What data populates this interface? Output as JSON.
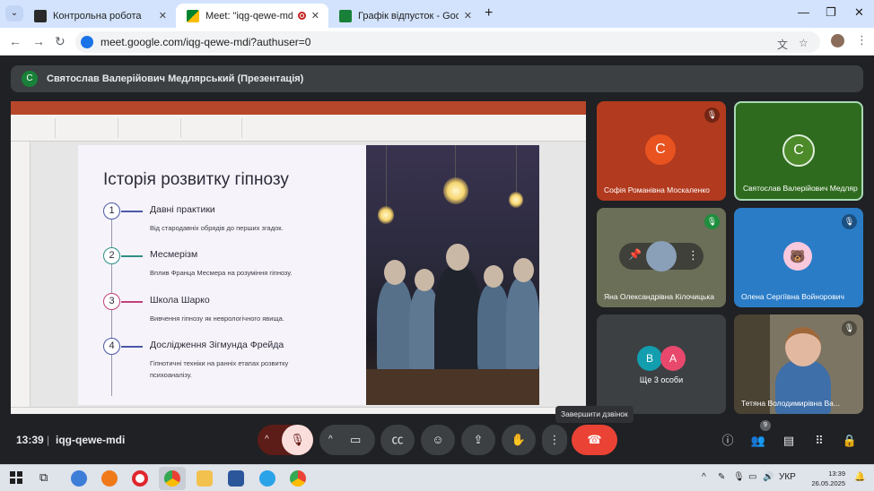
{
  "browser": {
    "tabs": [
      {
        "title": "Контрольна робота",
        "active": false
      },
      {
        "title": "Meet: \"iqg-qewe-mdi\"",
        "active": true
      },
      {
        "title": "Графік відпусток - Google Таб",
        "active": false
      }
    ],
    "url": "meet.google.com/iqg-qewe-mdi?authuser=0"
  },
  "meet": {
    "presenter_avatar": "С",
    "presenter_label": "Святослав Валерійович Медлярський (Презентація)",
    "slide": {
      "title": "Історія розвитку гіпнозу",
      "steps": [
        {
          "num": "1",
          "heading": "Давні практики",
          "desc": "Від стародавніх обрядів до перших згадок."
        },
        {
          "num": "2",
          "heading": "Месмерізм",
          "desc": "Вплив Франца Месмера на розуміння гіпнозу."
        },
        {
          "num": "3",
          "heading": "Школа Шарко",
          "desc": "Вивчення гіпнозу як неврологічного явища."
        },
        {
          "num": "4",
          "heading": "Дослідження Зігмунда Фрейда",
          "desc": "Гіпнотичні техніки на ранніх етапах розвитку психоаналізу."
        }
      ]
    },
    "participants": [
      {
        "avatar": "С",
        "name": "Софія Романівна Москаленко"
      },
      {
        "avatar": "С",
        "name": "Святослав Валерійович Медлярський"
      },
      {
        "avatar": "",
        "name": "Яна Олександрівна Кілочицька"
      },
      {
        "avatar": "",
        "name": "Олена Сергіївна Войнорович"
      },
      {
        "avatar_a": "В",
        "avatar_b": "А",
        "name": "Ще 3 особи"
      },
      {
        "avatar": "",
        "name": "Тетяна Володимирівна Ва..."
      }
    ],
    "controls": {
      "time": "13:39",
      "separator": "|",
      "meeting_code": "iqg-qewe-mdi",
      "end_call_tooltip": "Завершити дзвінок",
      "people_count": "9"
    }
  },
  "taskbar": {
    "language": "УКР",
    "time": "13:39",
    "date": "26.05.2025"
  },
  "colors": {
    "meet_bg": "#202124",
    "end_call": "#ea4335",
    "mic_off": "#f9dedc",
    "ppt_accent": "#b7472a",
    "tile_sofia": "#b23a1e",
    "tile_svyat": "#2e6b1e",
    "avatar_sofia": "#e8531f",
    "avatar_svyat": "#4c8a2a"
  }
}
